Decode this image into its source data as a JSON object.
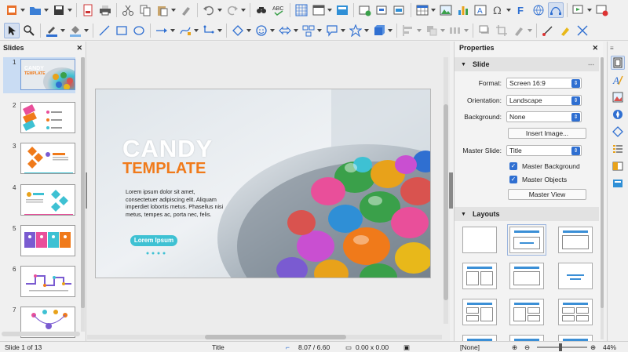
{
  "panels": {
    "slides_title": "Slides",
    "properties_title": "Properties"
  },
  "slides": [
    {
      "num": "1"
    },
    {
      "num": "2"
    },
    {
      "num": "3"
    },
    {
      "num": "4"
    },
    {
      "num": "5"
    },
    {
      "num": "6"
    },
    {
      "num": "7"
    }
  ],
  "slide": {
    "title": "CANDY",
    "subtitle": "TEMPLATE",
    "body": "Lorem ipsum dolor sit amet, consectetuer adipiscing elit. Aliquam imperdiet lobortis metus. Phasellus nisi metus, tempes ac, porta nec, felis.",
    "pill": "Lorem Ipsum",
    "thumb_title": "CANDY",
    "thumb_sub": "TEMPLATE"
  },
  "properties": {
    "slide_section": "Slide",
    "format_label": "Format:",
    "format_value": "Screen 16:9",
    "orientation_label": "Orientation:",
    "orientation_value": "Landscape",
    "background_label": "Background:",
    "background_value": "None",
    "insert_image": "Insert Image...",
    "master_slide_label": "Master Slide:",
    "master_slide_value": "Title",
    "master_background": "Master Background",
    "master_objects": "Master Objects",
    "master_view": "Master View",
    "layouts_section": "Layouts"
  },
  "status": {
    "slide_of": "Slide 1 of 13",
    "layout": "Title",
    "position": "8.07 / 6.60",
    "size": "0.00 x 0.00",
    "master": "[None]",
    "zoom": "44%"
  },
  "colors": {
    "accent": "#2f6fd1",
    "orange": "#f07a1a",
    "teal": "#3ec1d3",
    "selection": "#c9dcf3"
  }
}
